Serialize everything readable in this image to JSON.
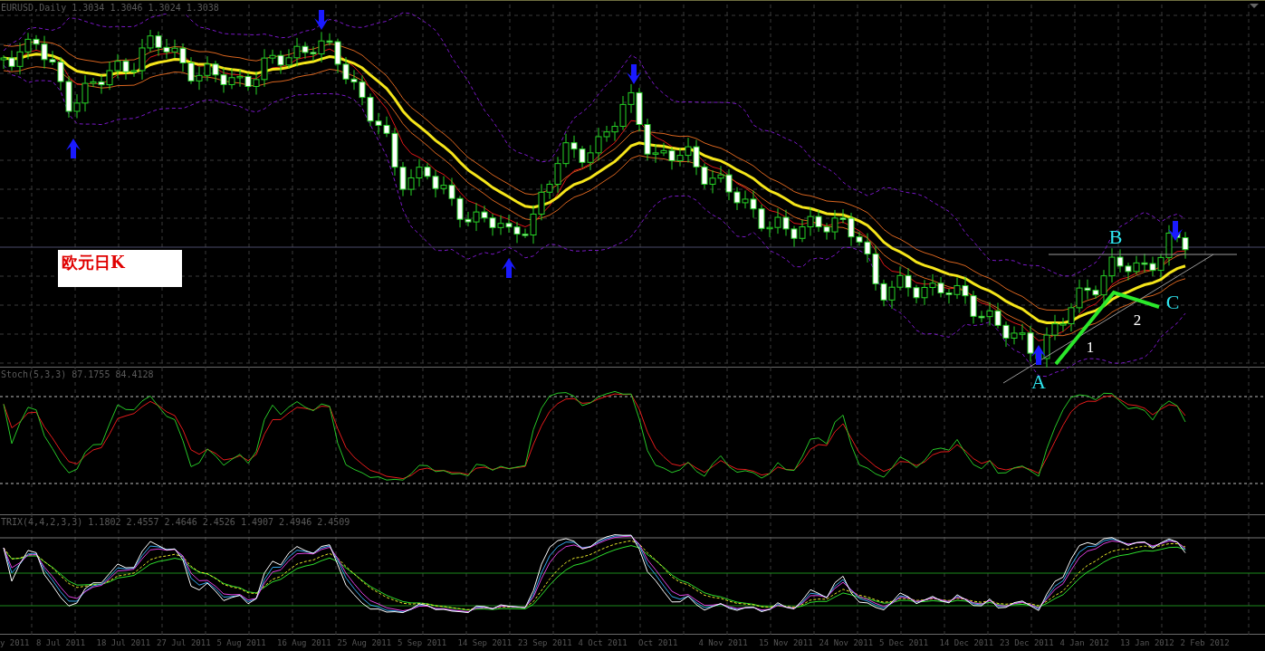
{
  "main_pane": {
    "header": "EURUSD,Daily 1.3034 1.3046 1.3024 1.3038",
    "note": "欧元日K",
    "wave_labels": [
      {
        "text": "B",
        "kind": "point"
      },
      {
        "text": "C",
        "kind": "point"
      },
      {
        "text": "2",
        "kind": "leg"
      },
      {
        "text": "1",
        "kind": "leg"
      },
      {
        "text": "A",
        "kind": "point"
      }
    ]
  },
  "stoch_pane": {
    "header": "Stoch(5,3,3) 87.1755 84.4128"
  },
  "osc_pane": {
    "header": "TRIX(4,4,2,3,3) 1.1802 2.4557 2.4646 2.4526 1.4907 2.4946 2.4509"
  },
  "time_axis": [
    "y 2011",
    "8 Jul 2011",
    "18 Jul 2011",
    "27 Jul 2011",
    "5 Aug 2011",
    "16 Aug 2011",
    "25 Aug 2011",
    "5 Sep 2011",
    "14 Sep 2011",
    "23 Sep 2011",
    "4 Oct 2011",
    "Oct 2011",
    "4 Nov 2011",
    "15 Nov 2011",
    "24 Nov 2011",
    "5 Dec 2011",
    "14 Dec 2011",
    "23 Dec 2011",
    "4 Jan 2012",
    "13 Jan 2012",
    "2 Feb 2012"
  ]
}
